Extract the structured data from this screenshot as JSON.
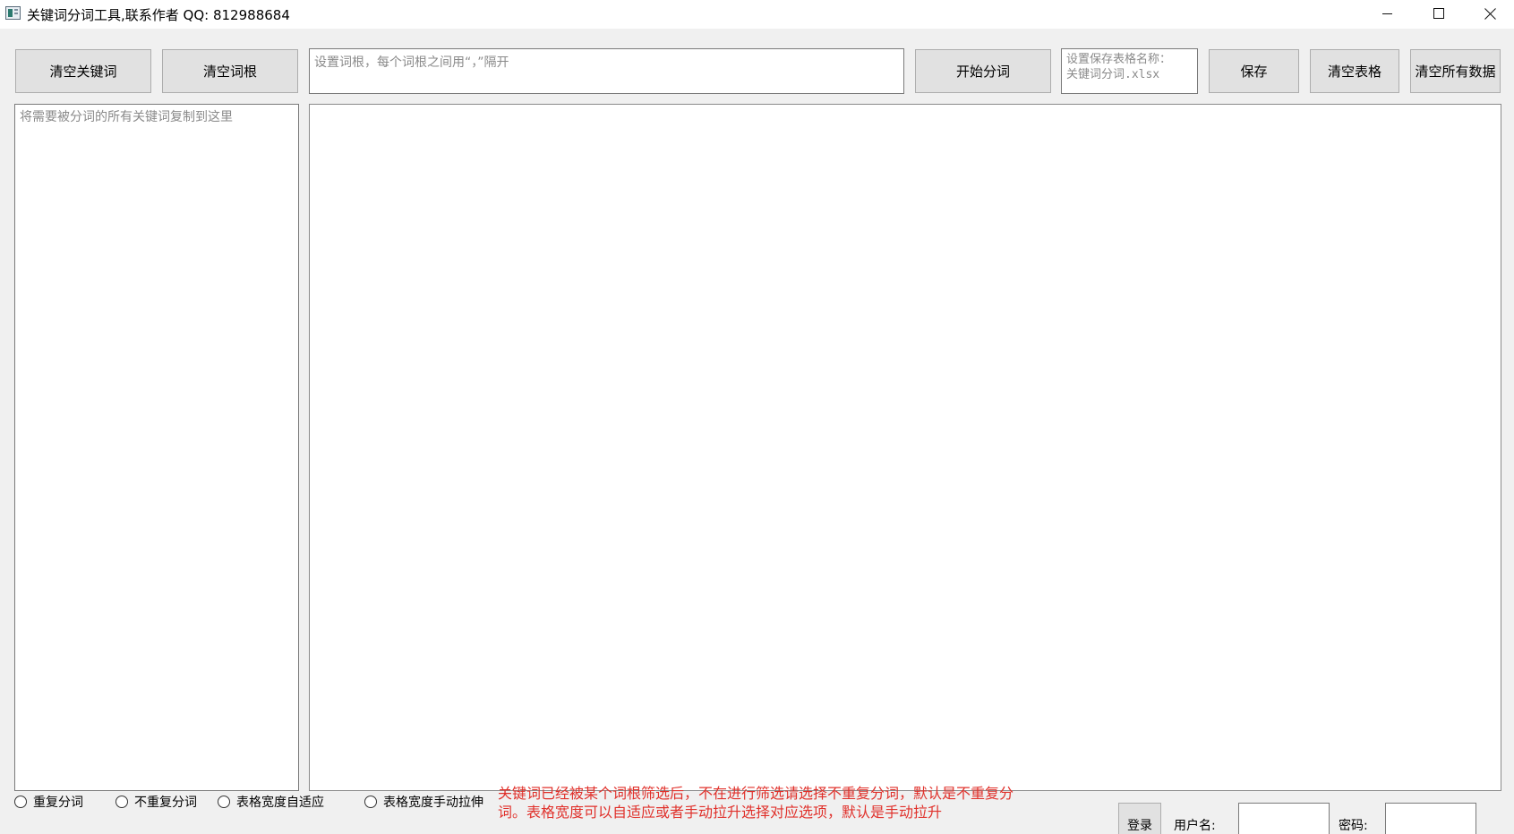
{
  "window": {
    "title": "关键词分词工具,联系作者 QQ:  812988684",
    "min_glyph": "minimize",
    "max_glyph": "maximize",
    "close_glyph": "close"
  },
  "toolbar": {
    "clear_keywords": "清空关键词",
    "clear_roots": "清空词根",
    "roots_placeholder": "设置词根，每个词根之间用“，”隔开",
    "start_segment": "开始分词",
    "filename_placeholder_line1": "设置保存表格名称：",
    "filename_placeholder_line2": "关键词分词.xlsx",
    "save": "保存",
    "clear_table": "清空表格",
    "clear_all": "清空所有数据"
  },
  "keywords_panel": {
    "placeholder": "将需要被分词的所有关键词复制到这里"
  },
  "options": {
    "repeat_segment": "重复分词",
    "no_repeat_segment": "不重复分词",
    "table_auto_width": "表格宽度自适应",
    "table_manual_width": "表格宽度手动拉伸"
  },
  "notice": {
    "line1": "关键词已经被某个词根筛选后，不在进行筛选请选择不重复分词，默认是不重复分",
    "line2": "词。表格宽度可以自适应或者手动拉升选择对应选项，默认是手动拉升",
    "color": "#e0312b"
  },
  "login": {
    "button": "登录",
    "username_label": "用户名:",
    "password_label": "密码:"
  },
  "colors": {
    "window_bg": "#f0f0f0",
    "button_bg": "#e1e1e1",
    "border": "#adadad"
  }
}
